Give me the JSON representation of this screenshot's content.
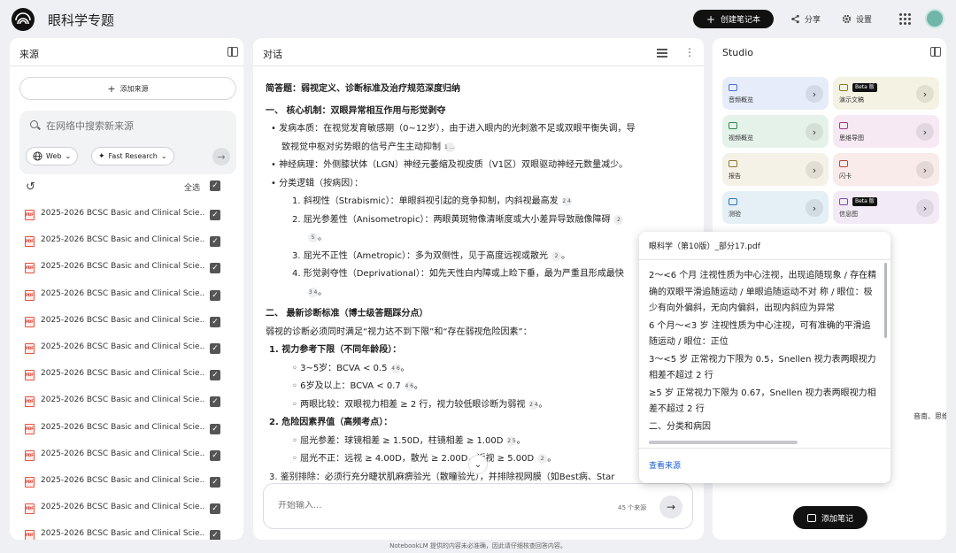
{
  "app": {
    "title": "眼科学专题",
    "create_label": "创建笔记本",
    "share_label": "分享",
    "settings_label": "设置"
  },
  "sources": {
    "title": "来源",
    "add_label": "添加来源",
    "search_placeholder": "在网络中搜索新来源",
    "chip_web": "Web",
    "chip_research": "Fast Research",
    "select_all": "全选",
    "items": [
      "2025-2026 BCSC Basic and Clinical Scie...",
      "2025-2026 BCSC Basic and Clinical Scie...",
      "2025-2026 BCSC Basic and Clinical Scie...",
      "2025-2026 BCSC Basic and Clinical Scie...",
      "2025-2026 BCSC Basic and Clinical Scie...",
      "2025-2026 BCSC Basic and Clinical Scie...",
      "2025-2026 BCSC Basic and Clinical Scie...",
      "2025-2026 BCSC Basic and Clinical Scie...",
      "2025-2026 BCSC Basic and Clinical Scie...",
      "2025-2026 BCSC Basic and Clinical Scie...",
      "2025-2026 BCSC Basic and Clinical Scie...",
      "2025-2026 BCSC Basic and Clinical Scie...",
      "2025-2026 BCSC Basic and Clinical Scie...",
      "2025-2026 BCSC Basic and Clinical Scie..."
    ]
  },
  "chat": {
    "title": "对话",
    "lines": [
      {
        "text": "简答题：弱视定义、诊断标准及治疗规范深度归纳",
        "bold": true,
        "indent": 0
      },
      {
        "text": "一、 核心机制：双眼异常相互作用与形觉剥夺",
        "bold": true,
        "indent": 0
      },
      {
        "text": "• 发病本质：在视觉发育敏感期（0~12岁），由于进入眼内的光刺激不足或双眼平衡失调，导",
        "indent": 6
      },
      {
        "text": "致视觉中枢对劣势眼的信号产生主动抑制",
        "cit": "1  …",
        "indent": 18
      },
      {
        "text": "• 神经病理：外侧膝状体（LGN）神经元萎缩及视皮质（V1区）双眼驱动神经元数量减少。",
        "indent": 6
      },
      {
        "text": "• 分类逻辑（按病因）：",
        "indent": 6
      },
      {
        "text": "1. 斜视性（Strabismic）：单眼斜视引起的竞争抑制，内斜视最高发",
        "cit": "2  4",
        "indent": 30
      },
      {
        "text": "2. 屈光参差性（Anisometropic）：两眼黄斑物像清晰度或大小差异导致融像障碍",
        "cit": "2",
        "indent": 30
      },
      {
        "text": "",
        "cit": "5",
        "tail": "。",
        "indent": 44
      },
      {
        "text": "3. 屈光不正性（Ametropic）：多为双侧性，见于高度远视或散光",
        "cit": "2",
        "tail": "。",
        "indent": 30
      },
      {
        "text": "4. 形觉剥夺性（Deprivational）：如先天性白内障或上睑下垂，最为严重且形成最快",
        "indent": 30
      },
      {
        "text": "",
        "cit": "3  4",
        "tail": "。",
        "indent": 44
      },
      {
        "text": "二、 最新诊断标准（博士级答题踩分点）",
        "bold": true,
        "indent": 0
      },
      {
        "text": "弱视的诊断必须同时满足“视力达不到下限”和“存在弱视危险因素”：",
        "indent": 0
      },
      {
        "text": "1. 视力参考下限（不同年龄段）：",
        "bold": true,
        "indent": 4
      },
      {
        "text": "◦ 3~5岁：BCVA < 0.5",
        "cit": "4  6",
        "tail": "。",
        "indent": 30
      },
      {
        "text": "◦ 6岁及以上：BCVA < 0.7",
        "cit": "4  6",
        "tail": "。",
        "indent": 30
      },
      {
        "text": "◦ 两眼比较：双眼视力相差 ≥ 2 行，视力较低眼诊断为弱视",
        "cit": "2  4",
        "tail": "。",
        "indent": 30
      },
      {
        "text": "2. 危险因素界值（高频考点）：",
        "bold": true,
        "indent": 4
      },
      {
        "text": "◦ 屈光参差：球镜相差 ≥ 1.50D，柱镜相差 ≥ 1.00D",
        "cit": "2  5",
        "tail": "。",
        "indent": 30
      },
      {
        "text": "◦ 屈光不正：远视 ≥ 4.00D，散光 ≥ 2.00D，近视 ≥ 5.00D",
        "cit": "2",
        "tail": "。",
        "indent": 30
      },
      {
        "text": "3. 鉴别排除：必须行充分睫状肌麻痹验光（散瞳验光），并排除视网膜（如Best病、Star",
        "indent": 4
      }
    ],
    "composer_placeholder": "开始输入...",
    "source_count": "45 个来源"
  },
  "studio": {
    "title": "Studio",
    "tiles": [
      {
        "label": "音频概览",
        "color": "#e6ecfa",
        "accent": "#4a6fd0"
      },
      {
        "label": "演示文稿",
        "color": "#f4f2e2",
        "accent": "#8a7a2a",
        "beta": "Beta 版"
      },
      {
        "label": "视频概览",
        "color": "#e5f2ea",
        "accent": "#2f8a55"
      },
      {
        "label": "思维导图",
        "color": "#f6e9f3",
        "accent": "#9b3f88"
      },
      {
        "label": "报告",
        "color": "#f4f1e6",
        "accent": "#8a7a3a"
      },
      {
        "label": "闪卡",
        "color": "#f8ebea",
        "accent": "#b04a3f"
      },
      {
        "label": "测验",
        "color": "#e4eff6",
        "accent": "#2f77a8"
      },
      {
        "label": "信息图",
        "color": "#f2eaf5",
        "accent": "#7f4aa0",
        "beta": "Beta 版"
      }
    ],
    "note_partial": "音南、思维导",
    "add_note_label": "添加笔记"
  },
  "popup": {
    "title": "眼科学（第10版）_部分17.pdf",
    "paragraphs": [
      "2～<6 个月 注视性质为中心注视，出现追随现象 / 存在精确的双眼平滑追随运动 / 单眼追随运动不对 称 / 眼位：极少有向外偏斜，无向内偏斜，出现内斜应为异常",
      "6 个月～<3 岁 注视性质为中心注视，可有准确的平滑追随运动 / 眼位：正位",
      "3～<5 岁 正常视力下限为 0.5，Snellen 视力表两眼视力相差不超过 2 行",
      "≥5 岁 正常视力下限为 0.67，Snellen 视力表两眼视力相差不超过 2 行",
      "二、分类和病因"
    ],
    "link": "查看来源"
  },
  "footer": "NotebookLM 提供的内容未必准确，因此请仔细核查回答内容。"
}
